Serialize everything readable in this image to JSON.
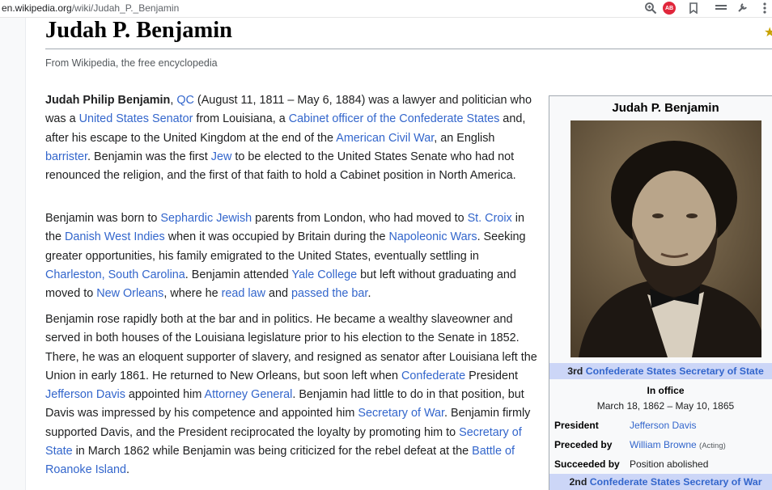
{
  "browser": {
    "url_host": "en.wikipedia.org",
    "url_path": "/wiki/Judah_P._Benjamin",
    "adblock_badge": "AB"
  },
  "article": {
    "title": "Judah P. Benjamin",
    "tagline": "From Wikipedia, the free encyclopedia",
    "p1": {
      "name": "Judah Philip Benjamin",
      "t1": ", ",
      "l1": "QC",
      "t2": " (August 11, 1811 – May 6, 1884) was a lawyer and politician who was a ",
      "l2": "United States Senator",
      "t3": " from Louisiana, a ",
      "l3": "Cabinet officer of the Confederate States",
      "t4": " and, after his escape to the United Kingdom at the end of the ",
      "l4": "American Civil War",
      "t5": ", an English ",
      "l5": "barrister",
      "t6": ". Benjamin was the first ",
      "l6": "Jew",
      "t7": " to be elected to the United States Senate who had not renounced the religion, and the first of that faith to hold a Cabinet position in North America."
    },
    "p2": {
      "t1": "Benjamin was born to ",
      "l1": "Sephardic Jewish",
      "t2": " parents from London, who had moved to ",
      "l2": "St. Croix",
      "t3": " in the ",
      "l3": "Danish West Indies",
      "t4": " when it was occupied by Britain during the ",
      "l4": "Napoleonic Wars",
      "t5": ". Seeking greater opportunities, his family emigrated to the United States, eventually settling in ",
      "l5": "Charleston, South Carolina",
      "t6": ". Benjamin attended ",
      "l6": "Yale College",
      "t7": " but left without graduating and moved to ",
      "l7": "New Orleans",
      "t8": ", where he ",
      "l8": "read law",
      "t9": " and ",
      "l9": "passed the bar",
      "t10": "."
    },
    "p3": {
      "t1": "Benjamin rose rapidly both at the bar and in politics. He became a wealthy slaveowner and served in both houses of the Louisiana legislature prior to his election to the Senate in 1852. There, he was an eloquent supporter of slavery, and resigned as senator after Louisiana left the Union in early 1861. He returned to New Orleans, but soon left when ",
      "l1": "Confederate",
      "t2": " President ",
      "l2": "Jefferson Davis",
      "t3": " appointed him ",
      "l3": "Attorney General",
      "t4": ". Benjamin had little to do in that position, but Davis was impressed by his competence and appointed him ",
      "l4": "Secretary of War",
      "t5": ". Benjamin firmly supported Davis, and the President reciprocated the loyalty by promoting him to ",
      "l5": "Secretary of State",
      "t6": " in March 1862 while Benjamin was being criticized for the rebel defeat at the ",
      "l6": "Battle of Roanoke Island",
      "t7": "."
    }
  },
  "infobox": {
    "title": "Judah P. Benjamin",
    "office1_prefix": "3rd ",
    "office1_link": "Confederate States Secretary of State",
    "in_office": "In office",
    "dates": "March 18, 1862 – May 10, 1865",
    "rows": [
      {
        "key": "President",
        "value": "Jefferson Davis",
        "note": ""
      },
      {
        "key": "Preceded by",
        "value": "William Browne",
        "note": "(Acting)"
      },
      {
        "key": "Succeeded by",
        "value": "Position abolished",
        "note": ""
      }
    ],
    "office2_prefix": "2nd ",
    "office2_link": "Confederate States Secretary of War"
  },
  "colors": {
    "link": "#3366cc",
    "infobox_bg": "#f8f9fa",
    "infobox_header": "#ccd6f7"
  }
}
